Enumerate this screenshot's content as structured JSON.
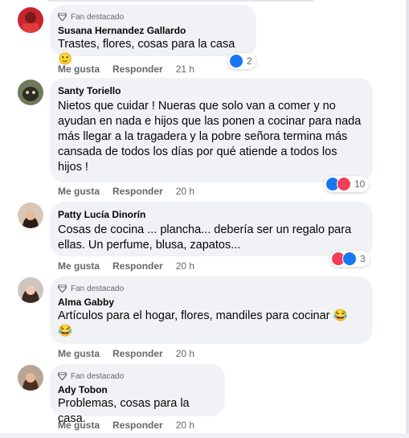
{
  "fan_label": "Fan destacado",
  "actions": {
    "like": "Me gusta",
    "reply": "Responder"
  },
  "colors": {
    "like": "#1877f2",
    "love": "#f33e58",
    "bubble": "#f0f2f5",
    "muted": "#65676b"
  },
  "comments": [
    {
      "fan": true,
      "name": "Susana Hernandez Gallardo",
      "text": "Trastes, flores, cosas para la casa 🙂",
      "time": "21 h",
      "reactions": [
        "like"
      ],
      "count": "2"
    },
    {
      "fan": false,
      "name": "Santy Toriello",
      "text": "Nietos que cuidar ! Nueras que solo van a comer y no ayudan en nada e hijos que las ponen a cocinar para nada más llegar a la tragadera y la pobre señora termina más cansada de todos los días por qué atiende a todos los hijos !",
      "time": "20 h",
      "reactions": [
        "like",
        "love"
      ],
      "count": "10"
    },
    {
      "fan": false,
      "name": "Patty Lucía Dinorín",
      "text": "Cosas de cocina ... plancha... debería ser un regalo para ellas. Un perfume, blusa, zapatos...",
      "time": "20 h",
      "reactions": [
        "love",
        "like"
      ],
      "count": "3"
    },
    {
      "fan": true,
      "name": "Alma Gabby",
      "text": "Artículos para el hogar, flores, mandiles para cocinar 😂 😂",
      "time": "20 h",
      "reactions": [],
      "count": ""
    },
    {
      "fan": true,
      "name": "Ady Tobon",
      "text": "Problemas, cosas para la casa.",
      "time": "20 h",
      "reactions": [],
      "count": ""
    }
  ]
}
